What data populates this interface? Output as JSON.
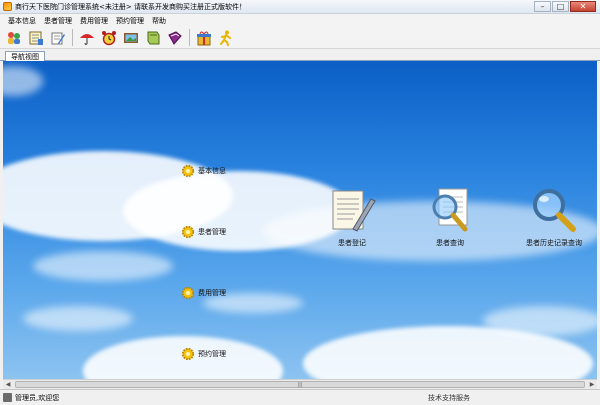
{
  "window": {
    "title": "商行天下医院门诊管理系统<未注册>  请联系开发商购买注册正式版软件！",
    "buttons": {
      "minimize": "–",
      "maximize": "□",
      "close": "✕"
    }
  },
  "menu": [
    "基本信息",
    "患者管理",
    "费用管理",
    "预约管理",
    "帮助"
  ],
  "toolbar": {
    "icons": [
      "people-icon",
      "notebook-icon",
      "edit-icon",
      "umbrella-icon",
      "alarm-clock-icon",
      "picture-icon",
      "book-icon",
      "book2-icon",
      "gift-icon",
      "runner-icon"
    ]
  },
  "tab": {
    "label": "导航视图"
  },
  "nav": {
    "basic_info": "基本信息",
    "patient_management": "患者管理",
    "fee_management": "费用管理",
    "appointment_management": "预约管理"
  },
  "shortcuts": {
    "register": "患者登记",
    "query": "患者查询",
    "history_query": "患者历史记录查询"
  },
  "scrollbar": {
    "grip": "|||"
  },
  "status": {
    "left": "管理员,欢迎您",
    "right": "技术支持服务"
  },
  "colors": {
    "sky_top": "#0b5fc6",
    "sky_bottom": "#8cc3f0",
    "accent": "#3b7bd1"
  }
}
